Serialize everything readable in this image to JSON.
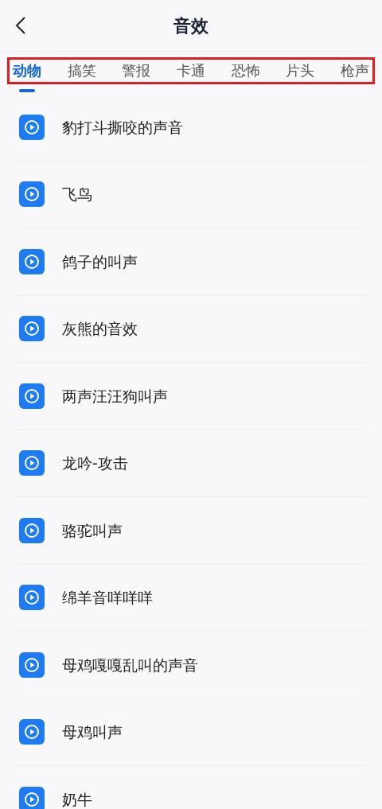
{
  "header": {
    "title": "音效"
  },
  "tabs": [
    {
      "label": "动物",
      "selected": true
    },
    {
      "label": "搞笑",
      "selected": false
    },
    {
      "label": "警报",
      "selected": false
    },
    {
      "label": "卡通",
      "selected": false
    },
    {
      "label": "恐怖",
      "selected": false
    },
    {
      "label": "片头",
      "selected": false
    },
    {
      "label": "枪声",
      "selected": false
    }
  ],
  "sounds": [
    {
      "name": "豹打斗撕咬的声音"
    },
    {
      "name": "飞鸟"
    },
    {
      "name": "鸽子的叫声"
    },
    {
      "name": "灰熊的音效"
    },
    {
      "name": "两声汪汪狗叫声"
    },
    {
      "name": "龙吟-攻击"
    },
    {
      "name": "骆驼叫声"
    },
    {
      "name": "绵羊音咩咩咩"
    },
    {
      "name": "母鸡嘎嘎乱叫的声音"
    },
    {
      "name": "母鸡叫声"
    },
    {
      "name": "奶牛"
    }
  ]
}
